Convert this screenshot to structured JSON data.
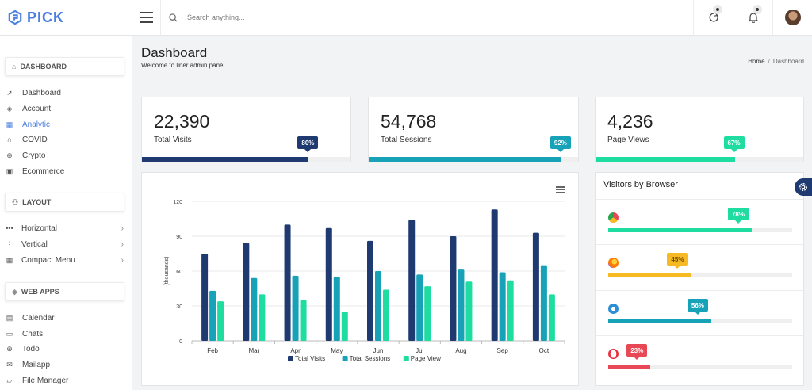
{
  "brand": {
    "name": "PICK"
  },
  "search": {
    "placeholder": "Search anything..."
  },
  "header_icons": [
    "loader-icon",
    "bell-icon",
    "user-avatar"
  ],
  "sidebar": {
    "sections": [
      {
        "title": "DASHBOARD",
        "icon": "home-icon",
        "items": [
          {
            "label": "Dashboard",
            "icon": "rocket-icon",
            "active": false
          },
          {
            "label": "Account",
            "icon": "layers-icon",
            "active": false
          },
          {
            "label": "Analytic",
            "icon": "grid-icon",
            "active": true
          },
          {
            "label": "COVID",
            "icon": "headphones-icon",
            "active": false
          },
          {
            "label": "Crypto",
            "icon": "globe-icon",
            "active": false
          },
          {
            "label": "Ecommerce",
            "icon": "briefcase-icon",
            "active": false
          }
        ]
      },
      {
        "title": "LAYOUT",
        "icon": "layout-icon",
        "items": [
          {
            "label": "Horizontal",
            "icon": "more-horizontal-icon",
            "has_submenu": true
          },
          {
            "label": "Vertical",
            "icon": "more-vertical-icon",
            "has_submenu": true
          },
          {
            "label": "Compact Menu",
            "icon": "grid-icon",
            "has_submenu": true
          }
        ]
      },
      {
        "title": "WEB APPS",
        "icon": "layers-icon",
        "items": [
          {
            "label": "Calendar",
            "icon": "calendar-icon"
          },
          {
            "label": "Chats",
            "icon": "chat-icon"
          },
          {
            "label": "Todo",
            "icon": "globe-icon"
          },
          {
            "label": "Mailapp",
            "icon": "mail-icon"
          },
          {
            "label": "File Manager",
            "icon": "folder-icon"
          }
        ]
      }
    ]
  },
  "page": {
    "title": "Dashboard",
    "subtitle": "Welcome to liner admin panel",
    "breadcrumb": {
      "home": "Home",
      "separator": "/",
      "current": "Dashboard"
    }
  },
  "stats": [
    {
      "value": "22,390",
      "label": "Total Visits",
      "percent_label": "80%",
      "percent": 80,
      "color": "#1e3a70"
    },
    {
      "value": "54,768",
      "label": "Total Sessions",
      "percent_label": "92%",
      "percent": 92,
      "color": "#17a2b8"
    },
    {
      "value": "4,236",
      "label": "Page Views",
      "percent_label": "67%",
      "percent": 67,
      "color": "#1fdda0"
    }
  ],
  "chart_data": {
    "type": "bar",
    "categories": [
      "Feb",
      "Mar",
      "Apr",
      "May",
      "Jun",
      "Jul",
      "Aug",
      "Sep",
      "Oct"
    ],
    "series": [
      {
        "name": "Total Visits",
        "color": "#1e3a70",
        "values": [
          75,
          84,
          100,
          97,
          86,
          104,
          90,
          113,
          93
        ]
      },
      {
        "name": "Total Sessions",
        "color": "#17a2b8",
        "values": [
          43,
          54,
          56,
          55,
          60,
          57,
          62,
          59,
          65
        ]
      },
      {
        "name": "Page View",
        "color": "#1fdda0",
        "values": [
          34,
          40,
          35,
          25,
          44,
          47,
          51,
          52,
          40
        ]
      }
    ],
    "yticks": [
      0,
      30,
      60,
      90,
      120
    ],
    "ylim": [
      0,
      120
    ],
    "ylabel": "(thousands)",
    "legend": "bottom-center",
    "grid": true
  },
  "browser_card": {
    "title": "Visitors by Browser",
    "rows": [
      {
        "browser_icon": "chrome-icon",
        "percent_label": "78%",
        "percent": 78,
        "color": "#1fdda0"
      },
      {
        "browser_icon": "firefox-icon",
        "percent_label": "45%",
        "percent": 45,
        "color": "#f7b924"
      },
      {
        "browser_icon": "ie-icon",
        "percent_label": "56%",
        "percent": 56,
        "color": "#17a2b8"
      },
      {
        "browser_icon": "opera-icon",
        "percent_label": "23%",
        "percent": 23,
        "color": "#e84855"
      }
    ]
  }
}
